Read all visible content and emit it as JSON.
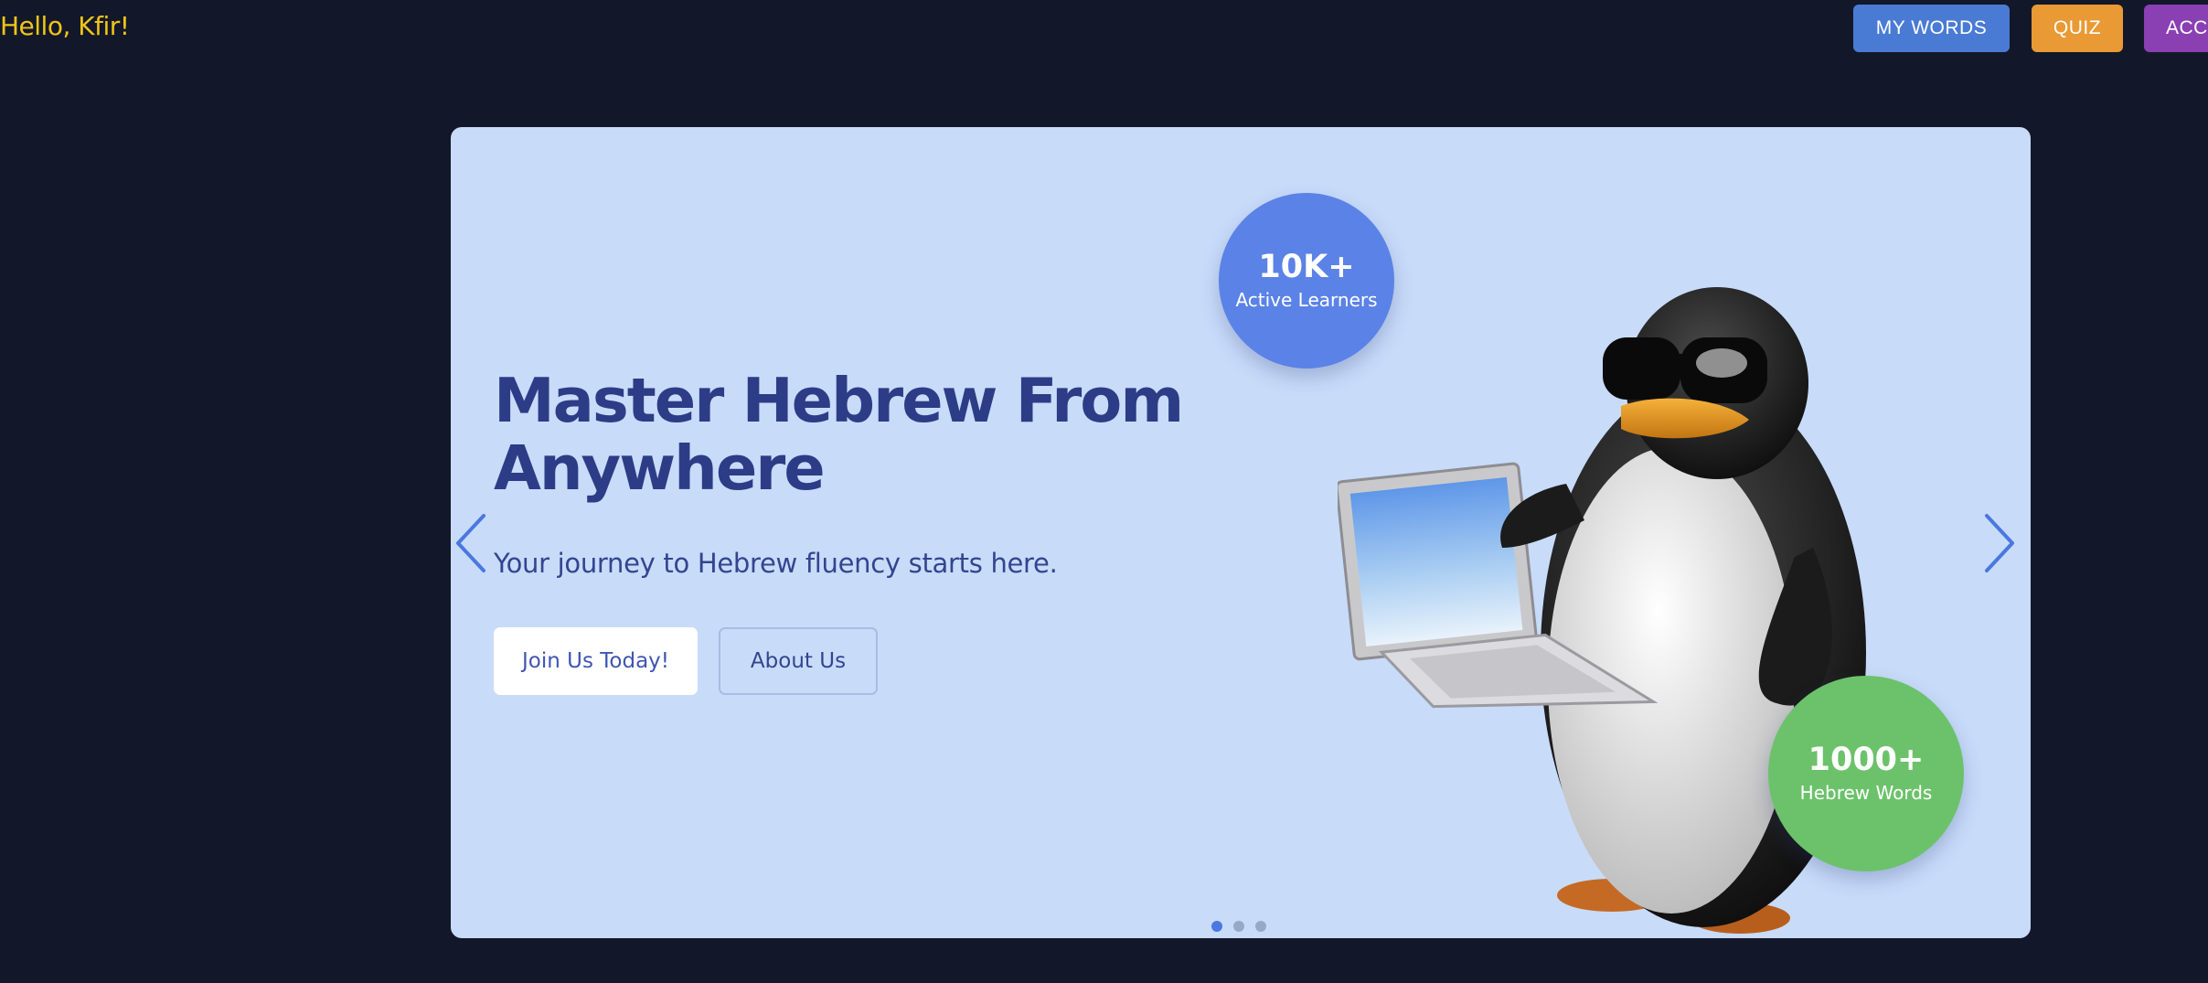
{
  "header": {
    "greeting": "Hello, Kfir!",
    "nav": {
      "my_words": "MY WORDS",
      "quiz": "QUIZ",
      "account": "ACCOUNT"
    },
    "colors": {
      "my_words": "#4a7bd4",
      "quiz": "#e99a35",
      "account": "#8a3fb3"
    }
  },
  "hero": {
    "title": "Master Hebrew From Anywhere",
    "subtitle": "Your journey to Hebrew fluency starts here.",
    "primary_button": "Join Us Today!",
    "secondary_button": "About Us",
    "stats": [
      {
        "value": "10K+",
        "label": "Active Learners"
      },
      {
        "value": "1000+",
        "label": "Hebrew Words"
      }
    ],
    "carousel": {
      "slide_count": 3,
      "active_slide": 1
    },
    "colors": {
      "background": "#c8dbf9",
      "title": "#2d3c86",
      "stat_learners": "#5b82e6",
      "stat_words": "#6cc26b"
    },
    "illustration": "penguin-with-laptop"
  }
}
